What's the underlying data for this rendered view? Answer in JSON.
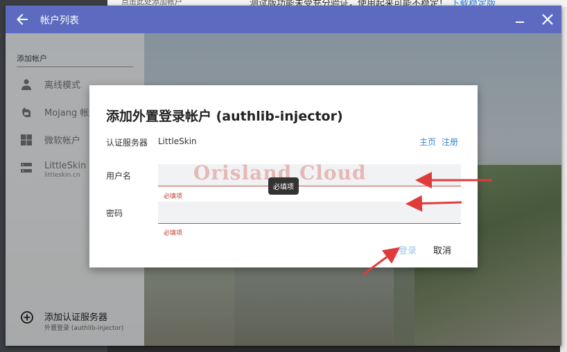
{
  "background": {
    "top_text": "测试版功能未受充分验证，使用起来可能不稳定！",
    "top_link": "下载稳定版",
    "left_top_text": "点击此处添加帐户"
  },
  "window": {
    "title": "帐户列表",
    "accent_color": "#5c6bc0"
  },
  "sidebar": {
    "header": "添加帐户",
    "items": [
      {
        "label": "离线模式",
        "icon": "person-icon"
      },
      {
        "label": "Mojang 帐户",
        "icon": "mojang-icon"
      },
      {
        "label": "微软帐户",
        "icon": "windows-icon"
      },
      {
        "label": "LittleSkin",
        "sublabel": "littleskin.cn",
        "icon": "server-icon"
      }
    ],
    "add_server": {
      "label": "添加认证服务器",
      "sublabel": "外置登录 (authlib-injector)",
      "icon": "add-circle-icon"
    }
  },
  "dialog": {
    "title": "添加外置登录帐户 (authlib-injector)",
    "server_label": "认证服务器",
    "server_value": "LittleSkin",
    "link_home": "主页",
    "link_register": "注册",
    "username_label": "用户名",
    "username_value": "",
    "username_error": "必填项",
    "password_label": "密码",
    "password_value": "",
    "password_error": "必填项",
    "tooltip": "必填项",
    "watermark": "Orisland Cloud",
    "login_button": "登录",
    "cancel_button": "取消"
  }
}
